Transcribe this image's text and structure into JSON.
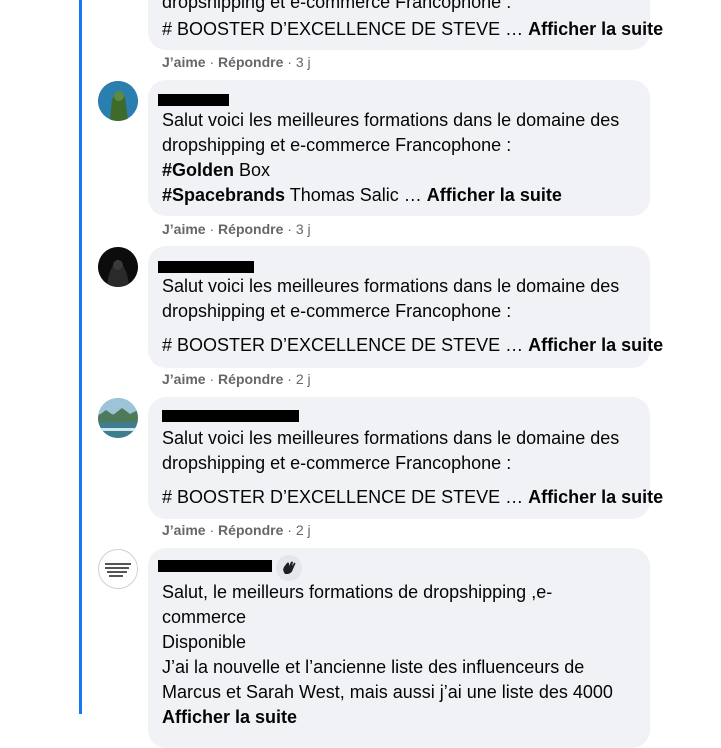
{
  "comments": [
    {
      "cut_line": "dropshipping et e-commerce Francophone :",
      "text_line": "# BOOSTER D’EXCELLENCE DE STEVE …",
      "more": "Afficher la suite",
      "like": "J’aime",
      "reply": "Répondre",
      "time": "3 j"
    },
    {
      "line1": "Salut voici les meilleures formations dans le domaine des",
      "line2": "dropshipping et e-commerce Francophone :",
      "line3_tag": "#Golden",
      "line3_rest": " Box",
      "line4_tag": "#Spacebrands",
      "line4_rest": " Thomas Salic …",
      "more": "Afficher la suite",
      "like": "J’aime",
      "reply": "Répondre",
      "time": "3 j"
    },
    {
      "line1": "Salut voici les meilleures formations dans le domaine des",
      "line2": "dropshipping et e-commerce Francophone :",
      "line3": "# BOOSTER D’EXCELLENCE DE STEVE …",
      "more": "Afficher la suite",
      "like": "J’aime",
      "reply": "Répondre",
      "time": "2 j"
    },
    {
      "line1": "Salut voici les meilleures formations dans le domaine des",
      "line2": "dropshipping et e-commerce Francophone :",
      "line3": "# BOOSTER D’EXCELLENCE DE STEVE …",
      "more": "Afficher la suite",
      "like": "J’aime",
      "reply": "Répondre",
      "time": "2 j"
    },
    {
      "badge_icon": "wave-icon",
      "line1": "Salut, le meilleurs formations de dropshipping ,e-",
      "line2": "commerce",
      "line3": "Disponible",
      "line4": "J’ai la nouvelle et l’ancienne liste des influenceurs de",
      "line5": "Marcus et Sarah West, mais aussi j’ai une liste des 4000",
      "more": "Afficher la suite"
    }
  ],
  "colors": {
    "thread": "#1877f2",
    "bubble": "#f0f2f5",
    "meta": "#65676b"
  }
}
